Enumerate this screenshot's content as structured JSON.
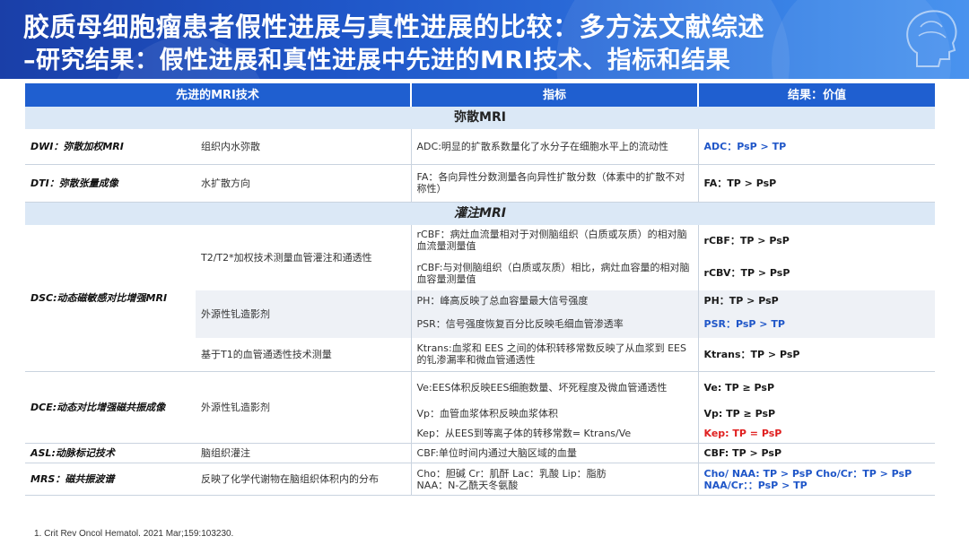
{
  "header": {
    "title": "胶质母细胞瘤患者假性进展与真性进展的比较：多方法文献综述",
    "subtitle": "–研究结果：假性进展和真性进展中先进的MRI技术、指标和结果"
  },
  "table": {
    "columns": [
      "先进的MRI技术",
      "指标",
      "结果：价值"
    ],
    "sections": {
      "diffusion": "弥散MRI",
      "perfusion": "灌注MRI"
    },
    "dwi": {
      "tech": "DWI：弥散加权MRI",
      "desc": "组织内水弥散",
      "ind": "ADC:明显的扩散系数量化了水分子在细胞水平上的流动性",
      "res": "ADC：PsP > TP"
    },
    "dti": {
      "tech": "DTI：弥散张量成像",
      "desc": "水扩散方向",
      "ind": "FA：各向异性分数测量各向异性扩散分数（体素中的扩散不对称性）",
      "res": "FA：TP > PsP"
    },
    "dsc": {
      "tech": "DSC:动态磁敏感对比增强MRI",
      "desc1": "T2/T2*加权技术测量血管灌注和通透性",
      "ind1": "rCBF：病灶血流量相对于对侧脑组织（白质或灰质）的相对脑血流量测量值",
      "res1": "rCBF：TP > PsP",
      "ind2": "rCBF:与对侧脑组织（白质或灰质）相比，病灶血容量的相对脑血容量测量值",
      "res2": "rCBV：TP > PsP",
      "desc2": "外源性钆造影剂",
      "ind3": "PH：峰高反映了总血容量最大信号强度",
      "res3": "PH：TP > PsP",
      "ind4": "PSR：信号强度恢复百分比反映毛细血管渗透率",
      "res4": "PSR：PsP > TP",
      "desc3": "基于T1的血管通透性技术测量",
      "ind5": "Ktrans:血浆和 EES 之间的体积转移常数反映了从血浆到 EES 的钆渗漏率和微血管通透性",
      "res5": "Ktrans：TP > PsP"
    },
    "dce": {
      "tech": "DCE:动态对比增强磁共振成像",
      "desc": "外源性钆造影剂",
      "ind1": "Ve:EES体积反映EES细胞数量、坏死程度及微血管通透性",
      "res1": "Ve: TP ≥ PsP",
      "ind2": "Vp：血管血浆体积反映血浆体积",
      "res2": "Vp: TP ≥ PsP",
      "ind3": "Kep：从EES到等离子体的转移常数= Ktrans/Ve",
      "res3": "Kep: TP = PsP"
    },
    "asl": {
      "tech": "ASL:动脉标记技术",
      "desc": "脑组织灌注",
      "ind": "CBF:单位时间内通过大脑区域的血量",
      "res": "CBF: TP > PsP"
    },
    "mrs": {
      "tech": "MRS：磁共振波谱",
      "desc": "反映了化学代谢物在脑组织体积内的分布",
      "ind1": "Cho：胆碱 Cr：肌酐 Lac：乳酸 Lip：脂肪",
      "ind2": "NAA：N-乙酰天冬氨酸",
      "res1": "Cho/ NAA: TP > PsP Cho/Cr：TP > PsP",
      "res2": "NAA/Cr：：PsP > TP"
    }
  },
  "footnote": "1.   Crit Rev Oncol Hematol. 2021 Mar;159:103230.",
  "colors": {
    "banner": "#1f56c8",
    "header_row": "#1f5fd0",
    "section_row": "#dbe8f6",
    "result_blue": "#1f56c8",
    "result_red": "#e02020"
  }
}
